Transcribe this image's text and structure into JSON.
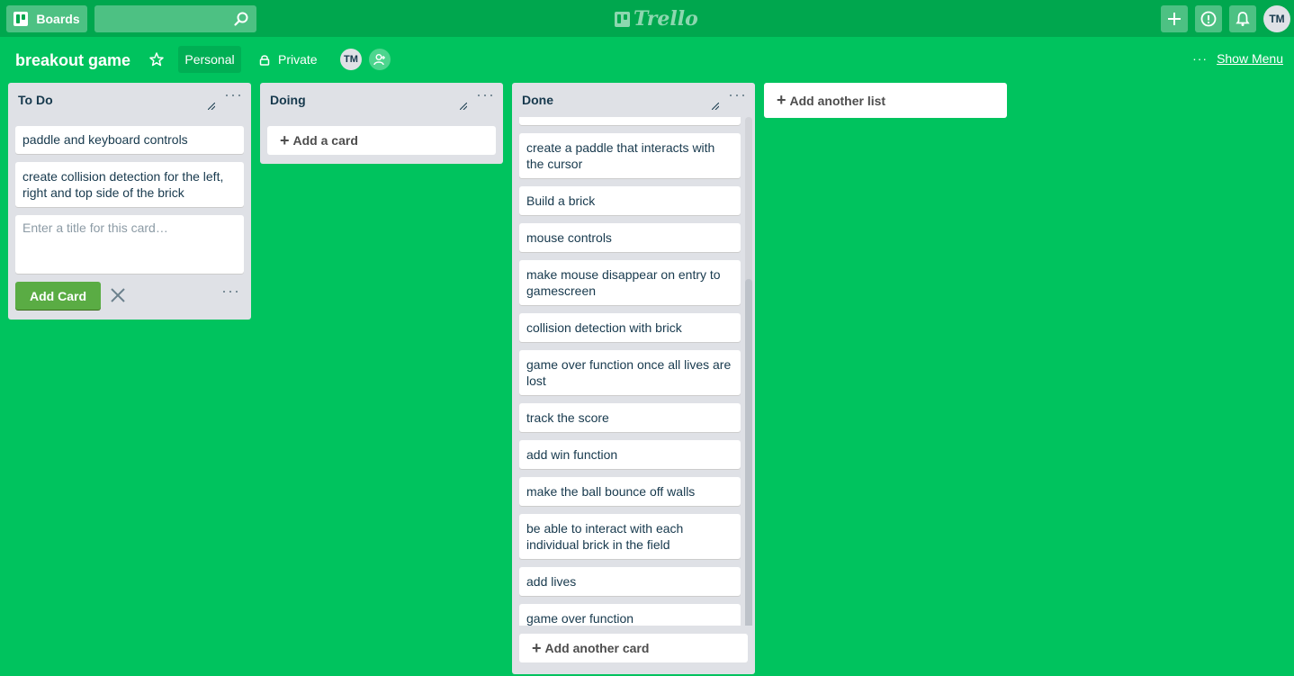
{
  "header": {
    "boards_label": "Boards",
    "search_placeholder": "",
    "logo_text": "Trello",
    "avatar_initials": "TM"
  },
  "board": {
    "title": "breakout game",
    "team_label": "Personal",
    "visibility_label": "Private",
    "member_initials": "TM",
    "menu_dots": "···",
    "show_menu_label": "Show Menu"
  },
  "lists": {
    "todo": {
      "title": "To Do",
      "cards": [
        "paddle and keyboard controls",
        "create collision detection for the left, right and top side of the brick"
      ],
      "composer_placeholder": "Enter a title for this card…",
      "add_card_button": "Add Card"
    },
    "doing": {
      "title": "Doing",
      "add_card_label": "Add a card"
    },
    "done": {
      "title": "Done",
      "cards": [
        "create a paddle that interacts with the cursor",
        "Build a brick",
        "mouse controls",
        "make mouse disappear on entry to gamescreen",
        "collision detection with brick",
        "game over function once all lives are lost",
        "track the score",
        "add win function",
        "make the ball bounce off walls",
        "be able to interact with each individual brick in the field",
        "add lives",
        "game over function"
      ],
      "add_card_label": "Add another card"
    }
  },
  "add_list_label": "Add another list",
  "colors": {
    "board_bg": "#00c35e",
    "header_bg": "#00a74e",
    "list_bg": "#dfe1e6",
    "add_button": "#5aac44"
  }
}
